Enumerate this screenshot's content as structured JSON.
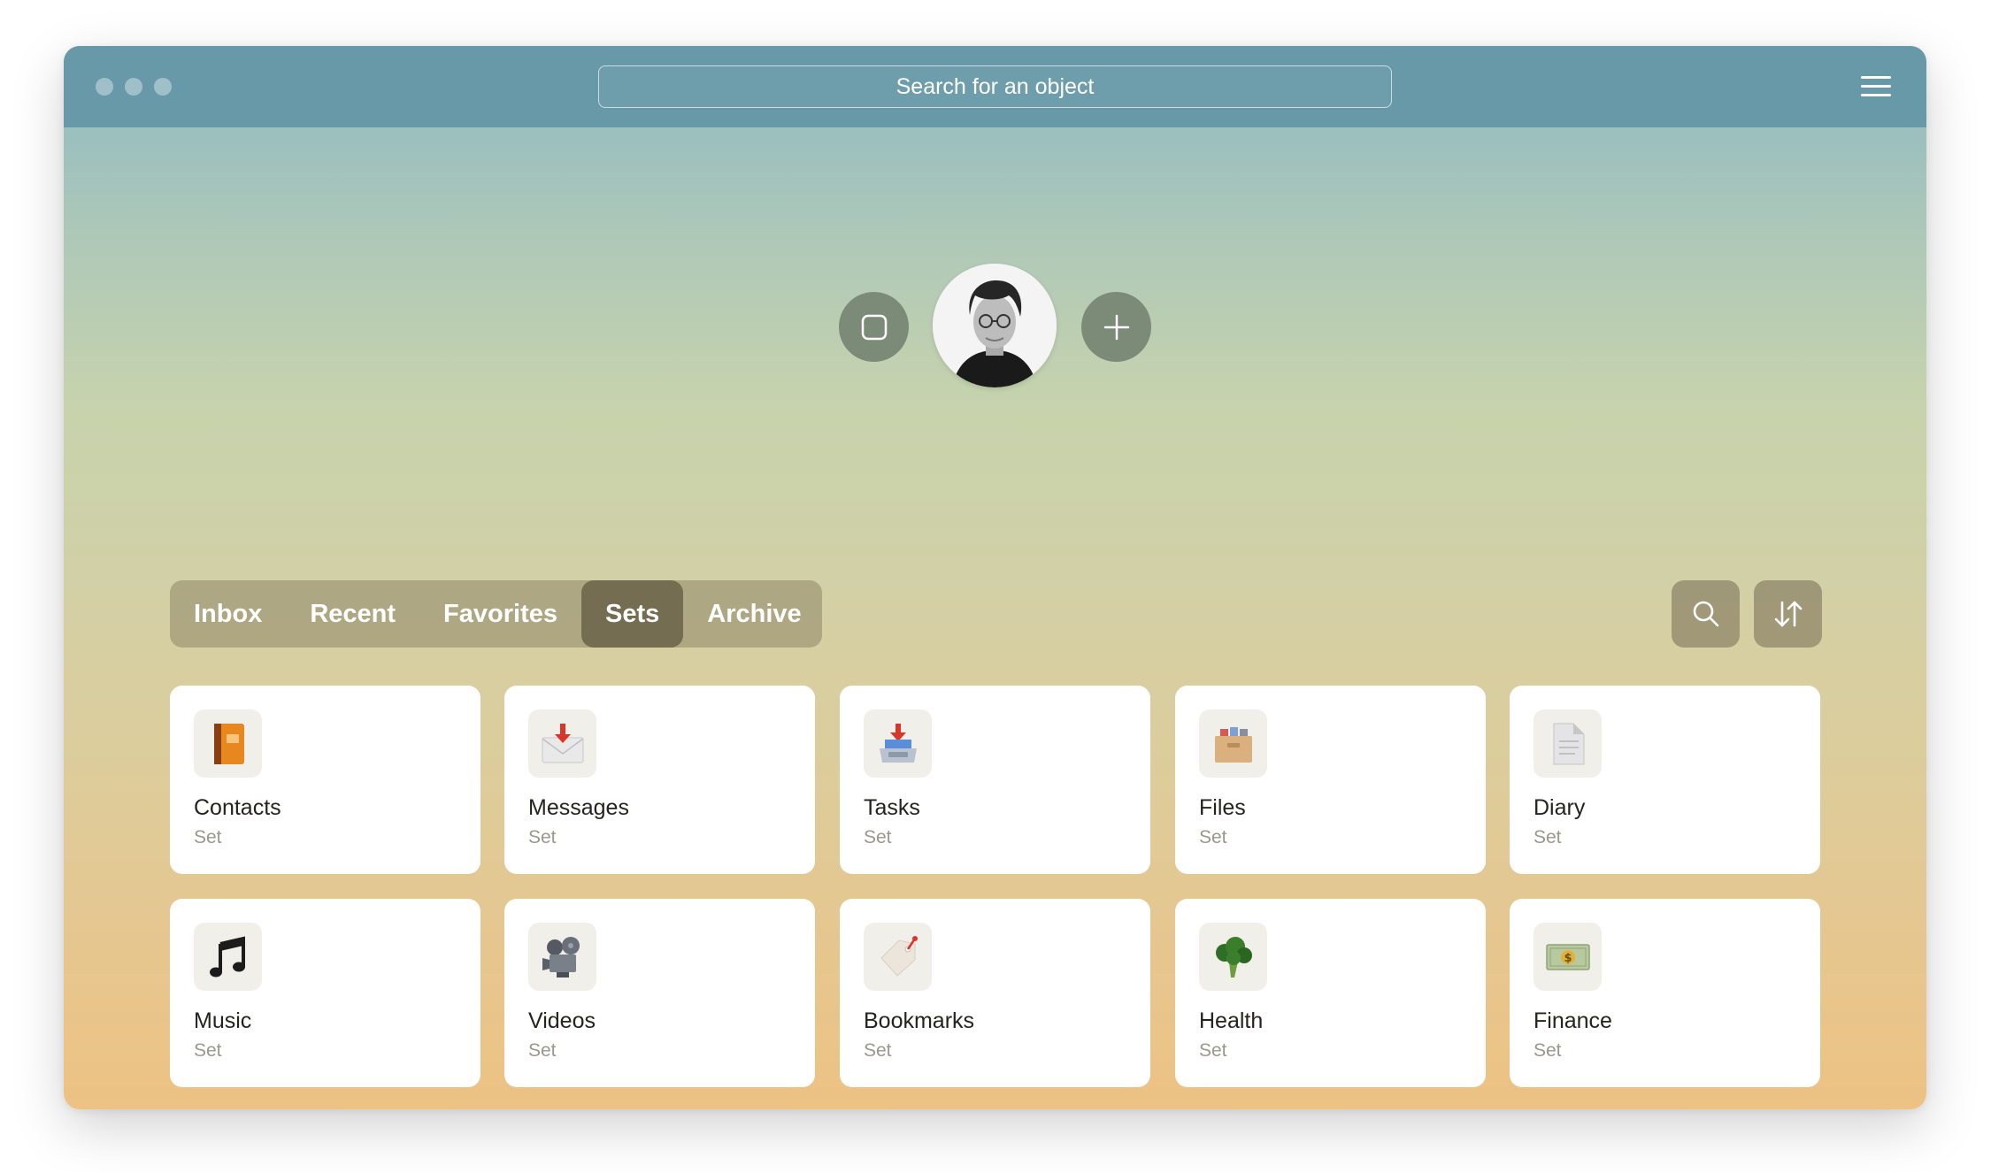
{
  "search": {
    "placeholder": "Search for an object"
  },
  "tabs": [
    {
      "label": "Inbox",
      "active": false
    },
    {
      "label": "Recent",
      "active": false
    },
    {
      "label": "Favorites",
      "active": false
    },
    {
      "label": "Sets",
      "active": true
    },
    {
      "label": "Archive",
      "active": false
    }
  ],
  "icons": {
    "menu": "hamburger-menu-icon",
    "store": "square-icon",
    "add": "plus-icon",
    "search": "search-icon",
    "sort": "sort-arrows-icon"
  },
  "cards": [
    {
      "title": "Contacts",
      "subtitle": "Set",
      "icon": "address-book-icon"
    },
    {
      "title": "Messages",
      "subtitle": "Set",
      "icon": "envelope-icon"
    },
    {
      "title": "Tasks",
      "subtitle": "Set",
      "icon": "inbox-tray-icon"
    },
    {
      "title": "Files",
      "subtitle": "Set",
      "icon": "card-file-box-icon"
    },
    {
      "title": "Diary",
      "subtitle": "Set",
      "icon": "page-icon"
    },
    {
      "title": "Music",
      "subtitle": "Set",
      "icon": "musical-note-icon"
    },
    {
      "title": "Videos",
      "subtitle": "Set",
      "icon": "film-projector-icon"
    },
    {
      "title": "Bookmarks",
      "subtitle": "Set",
      "icon": "bookmark-tag-icon"
    },
    {
      "title": "Health",
      "subtitle": "Set",
      "icon": "broccoli-icon"
    },
    {
      "title": "Finance",
      "subtitle": "Set",
      "icon": "dollar-banknote-icon"
    }
  ],
  "colors": {
    "titlebar": "#6799a8",
    "gradient_top": "#8cb9c3",
    "gradient_bottom": "#edc283",
    "button": "#7c8a78",
    "tab_active": "#625a40"
  }
}
